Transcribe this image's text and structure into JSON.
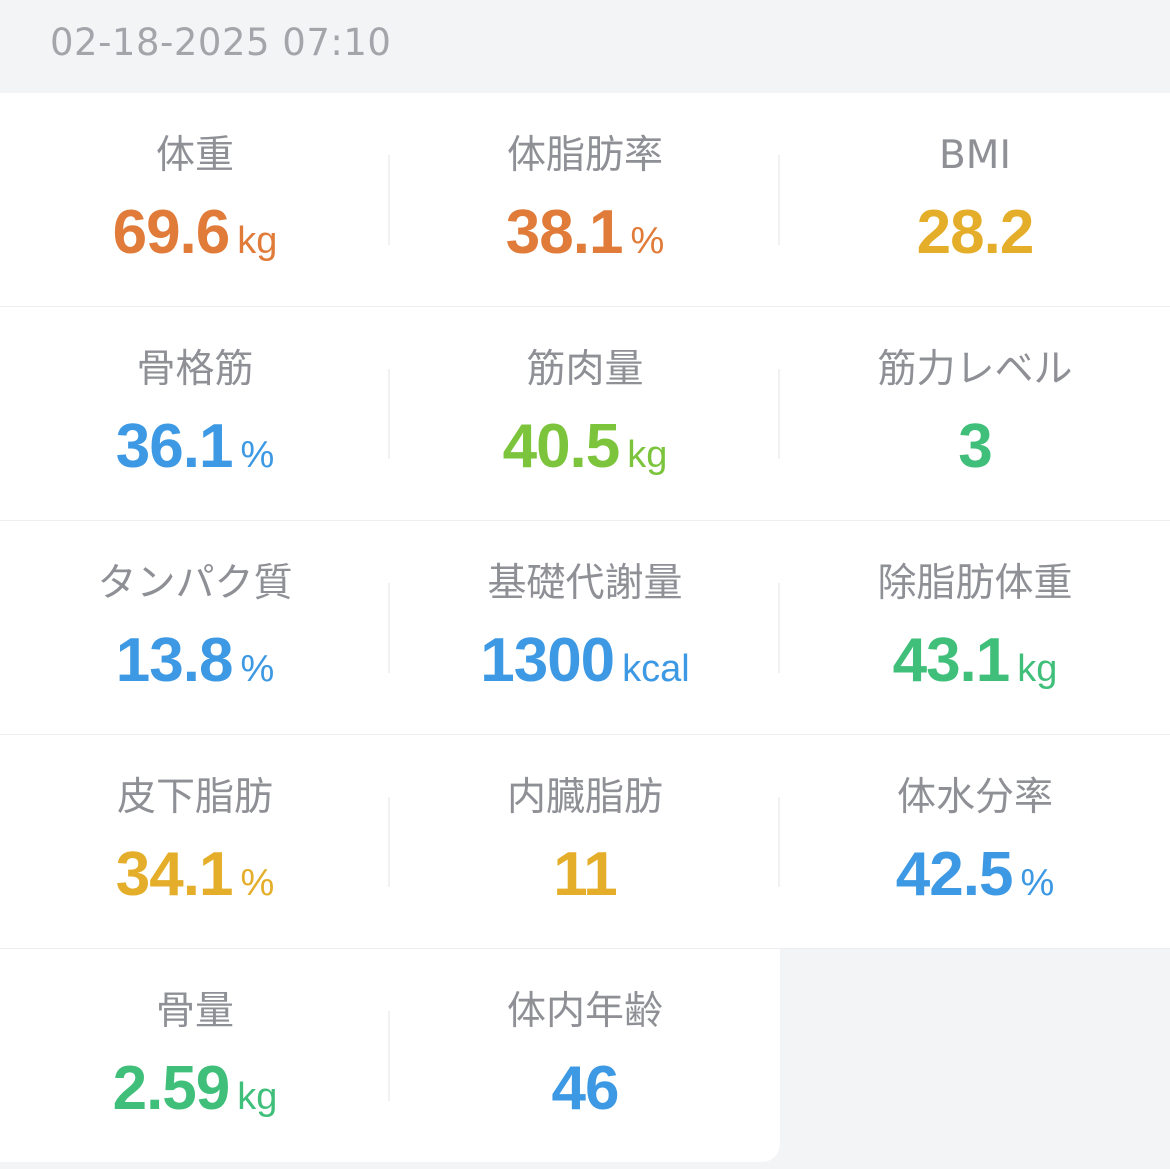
{
  "header": {
    "timestamp": "02-18-2025 07:10"
  },
  "colors": {
    "orange": "#e07b39",
    "yellow": "#e5ae2a",
    "blue": "#3d99e3",
    "lime": "#7bc43c",
    "green": "#3fbf7a"
  },
  "metrics": {
    "weight": {
      "label": "体重",
      "value": "69.6",
      "unit": "kg"
    },
    "body_fat": {
      "label": "体脂肪率",
      "value": "38.1",
      "unit": "%"
    },
    "bmi": {
      "label": "BMI",
      "value": "28.2",
      "unit": ""
    },
    "skeletal_muscle": {
      "label": "骨格筋",
      "value": "36.1",
      "unit": "%"
    },
    "muscle_mass": {
      "label": "筋肉量",
      "value": "40.5",
      "unit": "kg"
    },
    "muscle_level": {
      "label": "筋力レベル",
      "value": "3",
      "unit": ""
    },
    "protein": {
      "label": "タンパク質",
      "value": "13.8",
      "unit": "%"
    },
    "bmr": {
      "label": "基礎代謝量",
      "value": "1300",
      "unit": "kcal"
    },
    "lean_mass": {
      "label": "除脂肪体重",
      "value": "43.1",
      "unit": "kg"
    },
    "subcutaneous_fat": {
      "label": "皮下脂肪",
      "value": "34.1",
      "unit": "%"
    },
    "visceral_fat": {
      "label": "内臓脂肪",
      "value": "11",
      "unit": ""
    },
    "body_water": {
      "label": "体水分率",
      "value": "42.5",
      "unit": "%"
    },
    "bone_mass": {
      "label": "骨量",
      "value": "2.59",
      "unit": "kg"
    },
    "body_age": {
      "label": "体内年齢",
      "value": "46",
      "unit": ""
    }
  }
}
